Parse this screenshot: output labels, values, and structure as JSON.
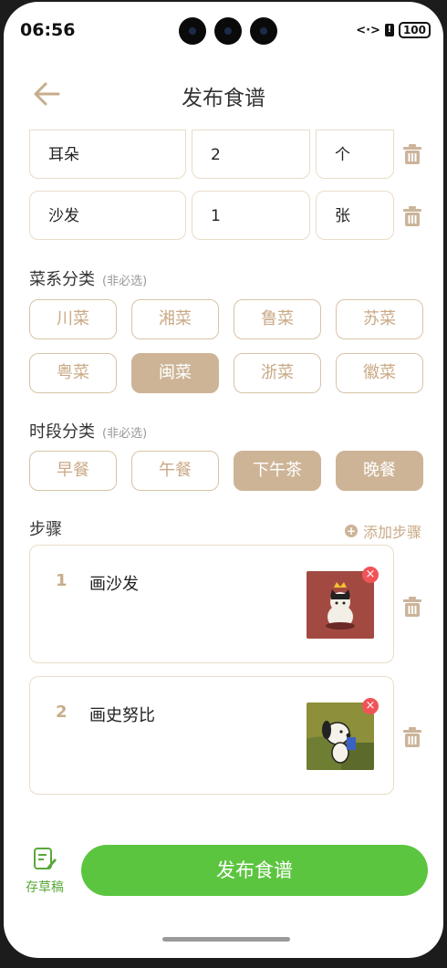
{
  "status_bar": {
    "time": "06:56",
    "code_icon": "<·>",
    "alert": "!",
    "battery": "100"
  },
  "header": {
    "title": "发布食谱",
    "back_icon": "arrow-left-icon"
  },
  "ingredients": [
    {
      "name": "耳朵",
      "amount": "2",
      "unit": "个"
    },
    {
      "name": "沙发",
      "amount": "1",
      "unit": "张"
    }
  ],
  "cuisine": {
    "title": "菜系分类",
    "optional": "(非必选)",
    "options": [
      {
        "label": "川菜",
        "selected": false
      },
      {
        "label": "湘菜",
        "selected": false
      },
      {
        "label": "鲁菜",
        "selected": false
      },
      {
        "label": "苏菜",
        "selected": false
      },
      {
        "label": "粤菜",
        "selected": false
      },
      {
        "label": "闽菜",
        "selected": true
      },
      {
        "label": "浙菜",
        "selected": false
      },
      {
        "label": "徽菜",
        "selected": false
      }
    ]
  },
  "meal_time": {
    "title": "时段分类",
    "optional": "(非必选)",
    "options": [
      {
        "label": "早餐",
        "selected": false
      },
      {
        "label": "午餐",
        "selected": false
      },
      {
        "label": "下午茶",
        "selected": true
      },
      {
        "label": "晚餐",
        "selected": true
      }
    ]
  },
  "steps": {
    "title": "步骤",
    "add_label": "添加步骤",
    "items": [
      {
        "number": "1",
        "text": "画沙发",
        "image": "cat-on-sofa-drawing"
      },
      {
        "number": "2",
        "text": "画史努比",
        "image": "snoopy-drawing"
      }
    ]
  },
  "footer": {
    "draft_label": "存草稿",
    "publish_label": "发布食谱"
  },
  "colors": {
    "accent": "#cdb496",
    "accent_text": "#caa985",
    "publish": "#5cc540",
    "delete": "#f05458"
  }
}
